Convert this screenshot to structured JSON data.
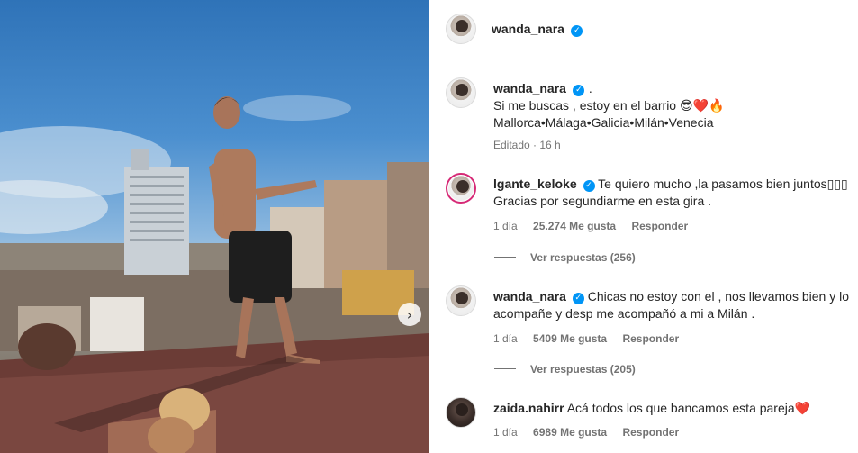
{
  "header": {
    "username": "wanda_nara",
    "verified_icon": "verified-badge-icon"
  },
  "caption": {
    "username": "wanda_nara",
    "dot": ".",
    "line1": "Si me buscas , estoy en el barrio 😎❤️🔥",
    "line2": "Mallorca•Málaga•Galicia•Milán•Venecia",
    "time": "Editado · 16 h"
  },
  "comments": [
    {
      "username": "lgante_keloke",
      "text": "Te quiero mucho ,la pasamos bien juntos▯▯▯",
      "text2": "Gracias por segundiarme en esta gira .",
      "time": "1 día",
      "likes": "25.274 Me gusta",
      "reply": "Responder",
      "view_replies": "Ver respuestas (256)"
    },
    {
      "username": "wanda_nara",
      "text": "Chicas no estoy con el , nos llevamos bien y lo",
      "text2": "acompañe y desp me acompañó a mi a Milán .",
      "time": "1 día",
      "likes": "5409 Me gusta",
      "reply": "Responder",
      "view_replies": "Ver respuestas (205)"
    },
    {
      "username": "zaida.nahirr",
      "text": "Acá todos los que bancamos esta pareja",
      "heart": "❤️",
      "time": "1 día",
      "likes": "6989 Me gusta",
      "reply": "Responder"
    }
  ],
  "media": {
    "next_icon": "chevron-right-icon",
    "next_glyph": "›"
  }
}
